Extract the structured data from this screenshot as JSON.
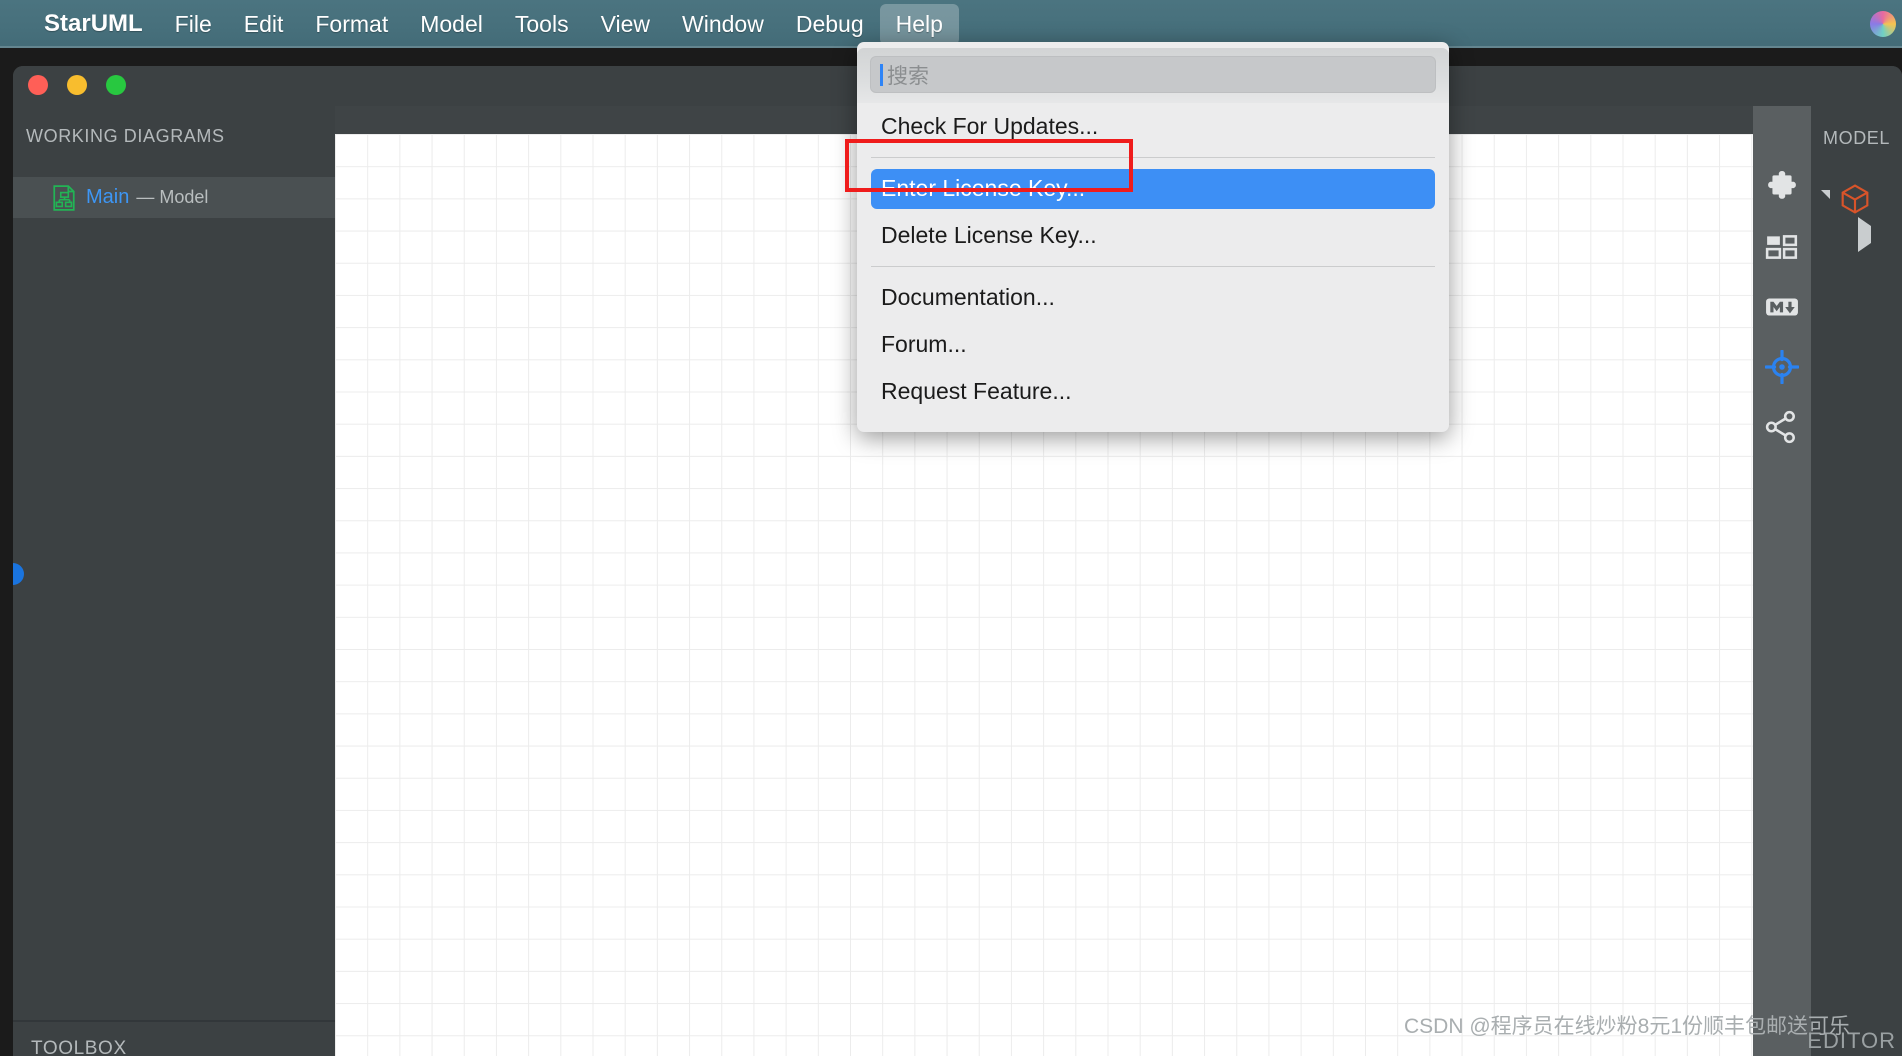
{
  "menubar": {
    "app": "StarUML",
    "items": [
      "File",
      "Edit",
      "Format",
      "Model",
      "Tools",
      "View",
      "Window",
      "Debug"
    ],
    "active_item": "Help",
    "status_icon": "siri-icon"
  },
  "window": {
    "traffic_lights": {
      "close": "close-button",
      "minimize": "minimize-button",
      "maximize": "maximize-button"
    }
  },
  "sidebar": {
    "header": "WORKING DIAGRAMS",
    "items": [
      {
        "icon": "diagram-icon",
        "name": "Main",
        "sub": "— Model"
      }
    ],
    "toolbox_label": "TOOLBOX"
  },
  "rail": {
    "icons": [
      "puzzle-extension-icon",
      "grid-layout-icon",
      "markdown-icon",
      "target-crosshair-icon",
      "share-network-icon"
    ]
  },
  "right_panel": {
    "title": "MODEL",
    "expander": "triangle-expander",
    "model_icon": "orange-cube-icon",
    "child_expander": "triangle-collapsed",
    "editor_label": "EDITOR"
  },
  "dropdown": {
    "search": {
      "placeholder": "搜索",
      "value": ""
    },
    "items": [
      {
        "label": "Check For Updates...",
        "highlighted": false,
        "separator_after": true
      },
      {
        "label": "Enter License Key...",
        "highlighted": true,
        "separator_after": false
      },
      {
        "label": "Delete License Key...",
        "highlighted": false,
        "separator_after": true
      },
      {
        "label": "Documentation...",
        "highlighted": false,
        "separator_after": false
      },
      {
        "label": "Forum...",
        "highlighted": false,
        "separator_after": false
      },
      {
        "label": "Request Feature...",
        "highlighted": false,
        "separator_after": false
      }
    ]
  },
  "annotation": {
    "type": "red-rectangle",
    "color": "#ef1c1c",
    "target": "Enter License Key..."
  },
  "watermark": {
    "text": "CSDN @程序员在线炒粉8元1份顺丰包邮送可乐"
  },
  "colors": {
    "menubar": "#47707c",
    "highlight_blue": "#3d8ff5",
    "link_blue": "#3d96f5",
    "panel_dark": "#3c4143",
    "annotation_red": "#ef1c1c",
    "model_orange": "#d8542a"
  }
}
